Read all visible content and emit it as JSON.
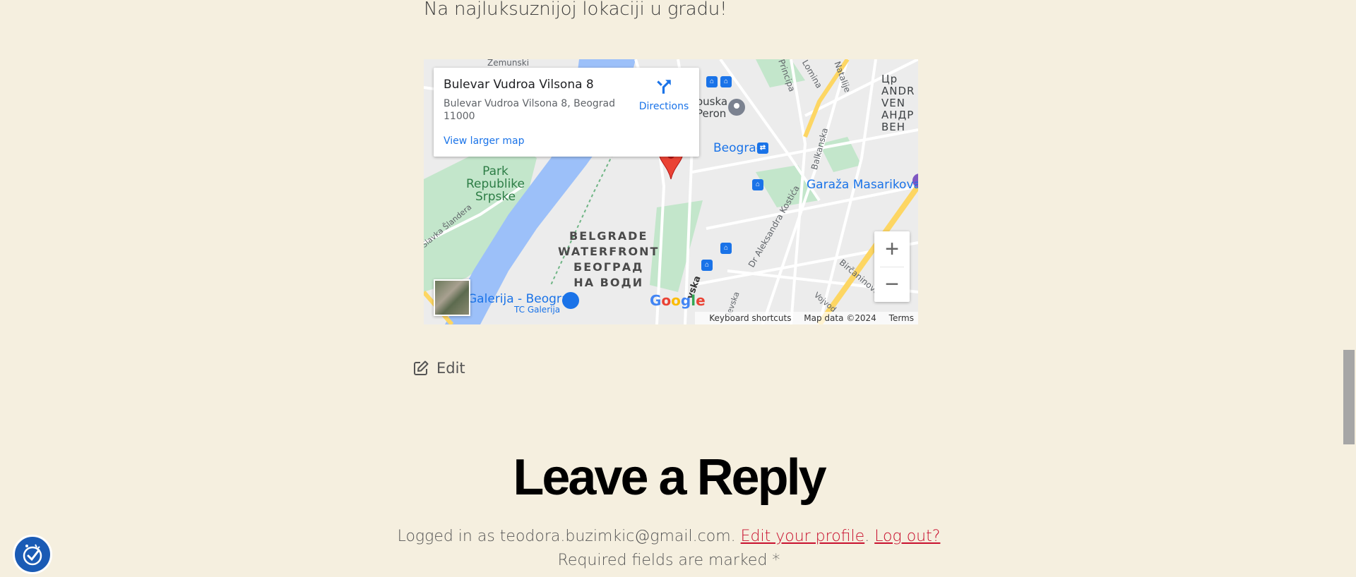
{
  "tagline": "Na najluksuznijoj lokaciji u gradu!",
  "map": {
    "infowindow": {
      "title": "Bulevar Vudroa Vilsona 8",
      "address": "Bulevar Vudroa Vilsona 8, Beograd 11000",
      "view_larger": "View larger map",
      "directions": "Directions"
    },
    "labels": {
      "zemunski": "Zemunski",
      "park": "Park\nRepublike\nSrpske",
      "slavka": "Slavka Šlandera",
      "bw": "BELGRADE\nWATERFRONT\nБЕОГРАД\nНА ВОДИ",
      "beograd": "Beograd",
      "garaza": "Garaža Masarikova",
      "galerija": "Galerija - Beograd",
      "tc_galerija": "TC Galerija",
      "andric": "Цр\nANDR\nVEN\nАНДР\nВЕН",
      "peron": "ouska\nPeron",
      "principa": "Principa",
      "balkanska": "Balkanska",
      "dr_kostica": "Dr Aleksandra Kostića",
      "bircaninova": "Birčaninova",
      "nemanjina": "vska",
      "vojvode": "Vojvod",
      "nevska": "levska",
      "natalije": "Natalije",
      "lomina": "Lomina"
    },
    "zoom_in": "+",
    "zoom_out": "−",
    "google": "Google",
    "keyboard": "Keyboard shortcuts",
    "map_data": "Map data ©2024",
    "terms": "Terms"
  },
  "edit_label": "Edit",
  "reply_title": "Leave a Reply",
  "logged_in": {
    "prefix": "Logged in as teodora.buzimkic@gmail.com.",
    "edit_profile": "Edit your profile",
    "sep": ".",
    "logout": "Log out?"
  },
  "required_note": "Required fields are marked *",
  "colors": {
    "background": "#f5efdf",
    "link": "#c8102e",
    "water": "#9cc0f9",
    "park": "#c3e6cb",
    "highway": "#fdd663",
    "pin": "#ea4335",
    "a11y_button": "#1a5bb5"
  }
}
